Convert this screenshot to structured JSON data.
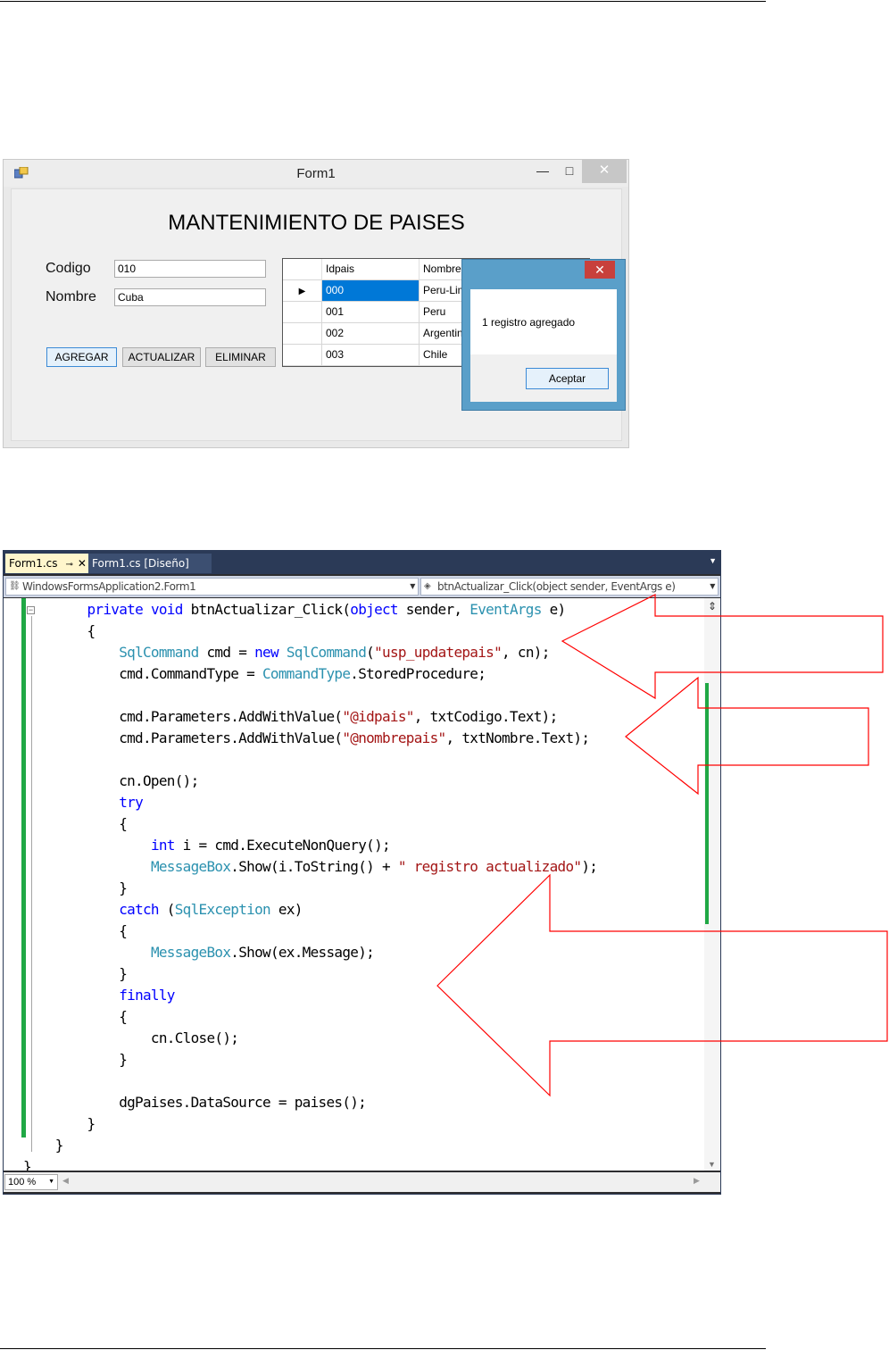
{
  "form": {
    "title": "Form1",
    "heading": "MANTENIMIENTO DE PAISES",
    "codigo_label": "Codigo",
    "codigo_value": "010",
    "nombre_label": "Nombre",
    "nombre_value": "Cuba",
    "buttons": {
      "agregar": "AGREGAR",
      "actualizar": "ACTUALIZAR",
      "eliminar": "ELIMINAR"
    },
    "grid": {
      "columns": [
        "Idpais",
        "NombreP"
      ],
      "rows": [
        {
          "id": "000",
          "nombre": "Peru-Lima"
        },
        {
          "id": "001",
          "nombre": "Peru"
        },
        {
          "id": "002",
          "nombre": "Argentina"
        },
        {
          "id": "003",
          "nombre": "Chile"
        }
      ],
      "row_indicator": "▶"
    },
    "message_box": {
      "text": "1 registro agregado",
      "ok_label": "Aceptar",
      "close_glyph": "✕"
    }
  },
  "ide": {
    "tabs": [
      "Form1.cs",
      "Form1.cs [Diseño]"
    ],
    "tab_pin": "⊸",
    "tab_close": "✕",
    "class_selector": "WindowsFormsApplication2.Form1",
    "member_selector": "btnActualizar_Click(object sender, EventArgs e)",
    "zoom": "100 %",
    "code_lines": [
      [
        {
          "t": "        "
        },
        {
          "t": "private",
          "c": "kw"
        },
        {
          "t": " "
        },
        {
          "t": "void",
          "c": "kw"
        },
        {
          "t": " btnActualizar_Click("
        },
        {
          "t": "object",
          "c": "kw"
        },
        {
          "t": " sender, "
        },
        {
          "t": "EventArgs",
          "c": "ty"
        },
        {
          "t": " e)"
        }
      ],
      [
        {
          "t": "        {"
        }
      ],
      [
        {
          "t": "            "
        },
        {
          "t": "SqlCommand",
          "c": "ty"
        },
        {
          "t": " cmd = "
        },
        {
          "t": "new",
          "c": "kw"
        },
        {
          "t": " "
        },
        {
          "t": "SqlCommand",
          "c": "ty"
        },
        {
          "t": "("
        },
        {
          "t": "\"usp_updatepais\"",
          "c": "st"
        },
        {
          "t": ", cn);"
        }
      ],
      [
        {
          "t": "            cmd.CommandType = "
        },
        {
          "t": "CommandType",
          "c": "ty"
        },
        {
          "t": ".StoredProcedure;"
        }
      ],
      [
        {
          "t": ""
        }
      ],
      [
        {
          "t": "            cmd.Parameters.AddWithValue("
        },
        {
          "t": "\"@idpais\"",
          "c": "st"
        },
        {
          "t": ", txtCodigo.Text);"
        }
      ],
      [
        {
          "t": "            cmd.Parameters.AddWithValue("
        },
        {
          "t": "\"@nombrepais\"",
          "c": "st"
        },
        {
          "t": ", txtNombre.Text);"
        }
      ],
      [
        {
          "t": ""
        }
      ],
      [
        {
          "t": "            cn.Open();"
        }
      ],
      [
        {
          "t": "            "
        },
        {
          "t": "try",
          "c": "kw"
        }
      ],
      [
        {
          "t": "            {"
        }
      ],
      [
        {
          "t": "                "
        },
        {
          "t": "int",
          "c": "kw"
        },
        {
          "t": " i = cmd.ExecuteNonQuery();"
        }
      ],
      [
        {
          "t": "                "
        },
        {
          "t": "MessageBox",
          "c": "ty"
        },
        {
          "t": ".Show(i.ToString() + "
        },
        {
          "t": "\" registro actualizado\"",
          "c": "st"
        },
        {
          "t": ");"
        }
      ],
      [
        {
          "t": "            }"
        }
      ],
      [
        {
          "t": "            "
        },
        {
          "t": "catch",
          "c": "kw"
        },
        {
          "t": " ("
        },
        {
          "t": "SqlException",
          "c": "ty"
        },
        {
          "t": " ex)"
        }
      ],
      [
        {
          "t": "            {"
        }
      ],
      [
        {
          "t": "                "
        },
        {
          "t": "MessageBox",
          "c": "ty"
        },
        {
          "t": ".Show(ex.Message);"
        }
      ],
      [
        {
          "t": "            }"
        }
      ],
      [
        {
          "t": "            "
        },
        {
          "t": "finally",
          "c": "kw"
        }
      ],
      [
        {
          "t": "            {"
        }
      ],
      [
        {
          "t": "                cn.Close();"
        }
      ],
      [
        {
          "t": "            }"
        }
      ],
      [
        {
          "t": ""
        }
      ],
      [
        {
          "t": "            dgPaises.DataSource = paises();"
        }
      ],
      [
        {
          "t": "        }"
        }
      ],
      [
        {
          "t": "    }"
        }
      ],
      [
        {
          "t": "}"
        }
      ]
    ]
  },
  "colors": {
    "keyword": "#0000ff",
    "type": "#2b91af",
    "string": "#a31515",
    "change_bar": "#20a845",
    "arrow_outline": "#ff0000"
  }
}
